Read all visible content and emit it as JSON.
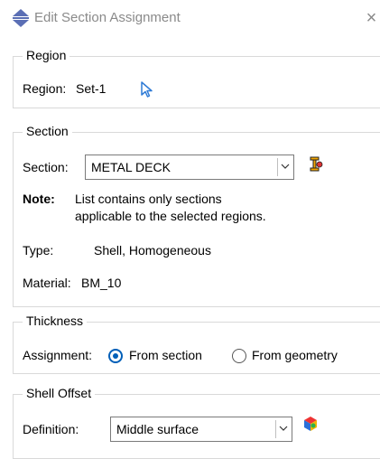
{
  "window": {
    "title": "Edit Section Assignment",
    "close_glyph": "×"
  },
  "region": {
    "legend": "Region",
    "label": "Region:",
    "value": "Set-1",
    "pick_icon": "arrow-pointer-icon"
  },
  "section": {
    "legend": "Section",
    "label": "Section:",
    "selected": "METAL DECK",
    "create_icon": "section-manager-icon",
    "note_label": "Note:",
    "note_line1": "List contains only sections",
    "note_line2": "applicable to the selected regions.",
    "type_label": "Type:",
    "type_value": "Shell, Homogeneous",
    "material_label": "Material:",
    "material_value": "BM_10"
  },
  "thickness": {
    "legend": "Thickness",
    "assignment_label": "Assignment:",
    "options": [
      "From section",
      "From geometry"
    ],
    "selected_index": 0
  },
  "shell_offset": {
    "legend": "Shell Offset",
    "definition_label": "Definition:",
    "selected": "Middle surface",
    "pick_icon": "color-cube-icon"
  },
  "colors": {
    "accent": "#005fb8",
    "pick_arrow": "#2f7bd6"
  }
}
